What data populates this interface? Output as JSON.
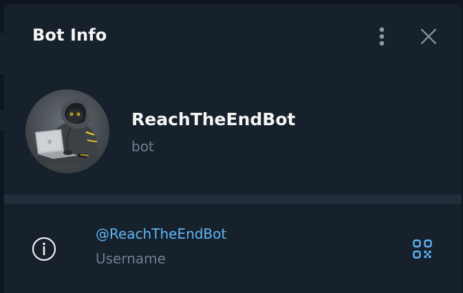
{
  "dialog": {
    "title": "Bot Info",
    "more_icon": "more-vertical-icon",
    "close_icon": "close-icon"
  },
  "profile": {
    "name": "ReachTheEndBot",
    "subtitle": "bot",
    "avatar_icon": "hooded-cat-with-laptop-avatar"
  },
  "info": {
    "username": "@ReachTheEndBot",
    "username_label": "Username",
    "info_icon": "info-icon",
    "qr_icon": "qr-code-icon"
  },
  "colors": {
    "background": "#17212b",
    "divider": "#232e3c",
    "primary_text": "#f5f5f5",
    "secondary_text": "#6d7f8f",
    "link": "#5eb5f7",
    "icon": "#8b9aa8"
  }
}
